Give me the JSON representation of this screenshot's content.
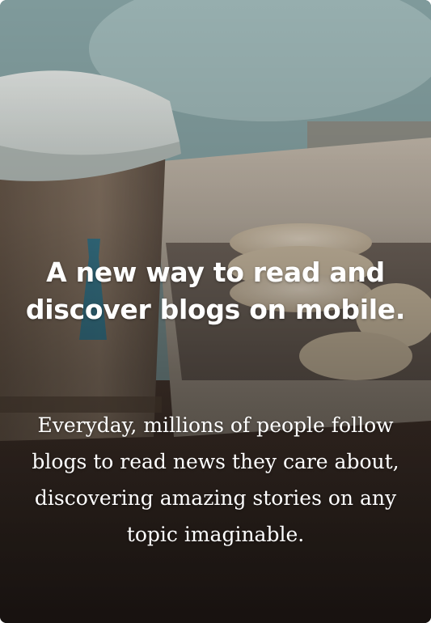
{
  "hero": {
    "headline": "A new way to read and discover blogs on mobile.",
    "description": "Everyday, millions of people follow blogs to read news they care about, discovering amazing stories on any topic imaginable."
  },
  "background": {
    "image": "coffee-cup-and-macarons-photo",
    "accent_color": "#2e7a94"
  }
}
